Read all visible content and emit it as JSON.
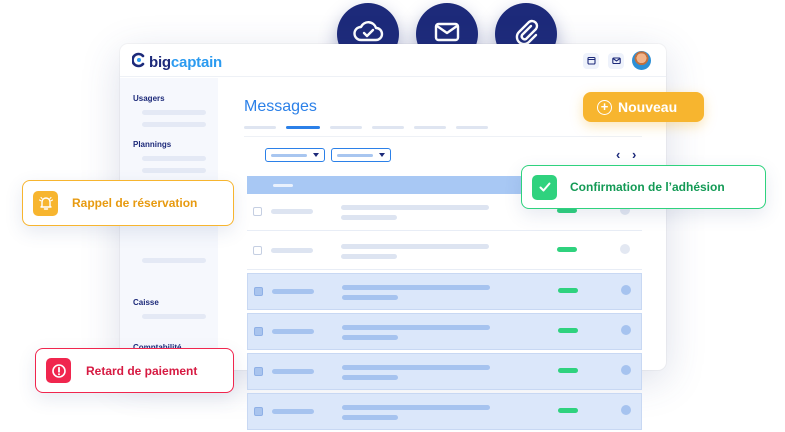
{
  "top_icons": [
    "cloud-check-icon",
    "mail-icon",
    "paperclip-icon"
  ],
  "app": {
    "logo": {
      "part1": "big",
      "part2": "captain"
    },
    "topbar_icons": [
      "calendar-icon",
      "mail-icon"
    ],
    "sidebar": {
      "sections": [
        "Usagers",
        "Plannings",
        "Caisse",
        "Comptabilité"
      ]
    },
    "page_title": "Messages",
    "nav": {
      "prev": "‹",
      "next": "›"
    }
  },
  "notifications": {
    "nouveau": "Nouveau",
    "rappel": "Rappel de réservation",
    "confirmation": "Confirmation de l’adhésion",
    "retard": "Retard de paiement"
  },
  "colors": {
    "brand_navy": "#1d2a7a",
    "accent_blue": "#2b80e8",
    "warning_yellow": "#f7b52f",
    "success_green": "#2fd27e",
    "danger_red": "#f0264e"
  }
}
